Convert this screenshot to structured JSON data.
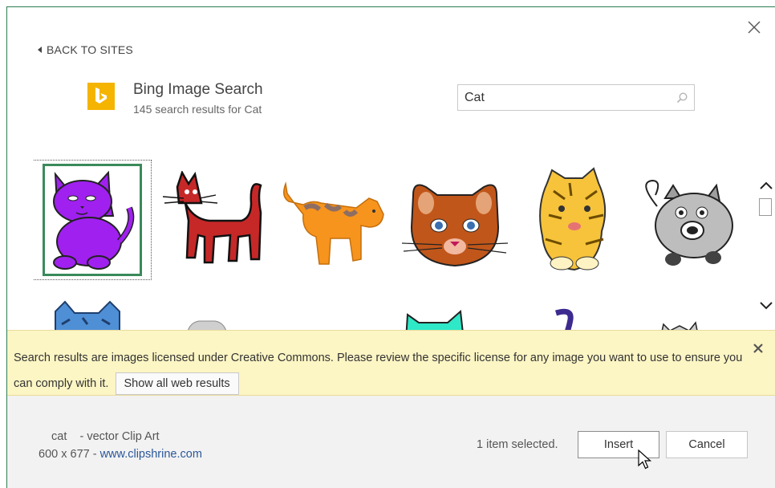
{
  "nav": {
    "back_label": "BACK TO SITES"
  },
  "header": {
    "title": "Bing Image Search",
    "subtitle": "145 search results for Cat"
  },
  "search": {
    "value": "Cat"
  },
  "colors": {
    "accent_green": "#3a8a5a",
    "bing_yellow": "#f5b400",
    "notice_bg": "#fcf5c4",
    "link_blue": "#2b579a"
  },
  "results": {
    "items": [
      {
        "name": "purple-cat",
        "selected": true
      },
      {
        "name": "red-cat",
        "selected": false
      },
      {
        "name": "orange-cat",
        "selected": false
      },
      {
        "name": "brown-cat-face",
        "selected": false
      },
      {
        "name": "yellow-cat",
        "selected": false
      },
      {
        "name": "gray-cat",
        "selected": false
      }
    ]
  },
  "notice": {
    "text": "Search results are images licensed under Creative Commons. Please review the specific license for any image you want to use to ensure you can comply with it.",
    "button_label": "Show all web results"
  },
  "footer": {
    "item_name": "cat    - vector Clip Art",
    "dimensions": "600 x 677 - ",
    "source_link": "www.clipshrine.com",
    "selected_count": "1 item selected.",
    "insert_label": "Insert",
    "cancel_label": "Cancel"
  },
  "icons": {
    "close": "close-icon",
    "search": "search-icon",
    "back": "back-arrow-icon",
    "bing": "bing-logo-icon",
    "scroll_up": "chevron-up-icon",
    "scroll_down": "chevron-down-icon",
    "notice_close": "close-icon"
  }
}
